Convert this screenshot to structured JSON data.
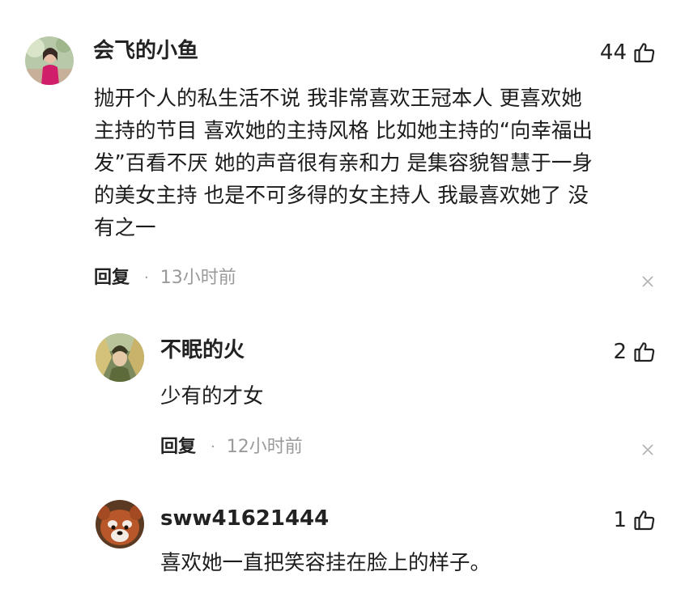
{
  "comments": [
    {
      "username": "会飞的小鱼",
      "likes": "44",
      "text_lines": [
        "抛开个人的私生活不说 我非常喜欢王冠本人 更喜欢她",
        "主持的节目 喜欢她的主持风格 比如她主持的“向幸福出",
        "发”百看不厌 她的声音很有亲和力 是集容貌智慧于一身",
        "的美女主持 也是不可多得的女主持人 我最喜欢她了 没",
        "有之一"
      ],
      "reply_label": "回复",
      "time": "13小时前"
    },
    {
      "username": "不眠的火",
      "likes": "2",
      "text_lines": [
        "少有的才女"
      ],
      "reply_label": "回复",
      "time": "12小时前"
    },
    {
      "username": "sww41621444",
      "likes": "1",
      "text_lines": [
        "喜欢她一直把笑容挂在脸上的样子。"
      ]
    }
  ],
  "icons": {
    "like": "thumbs-up-icon",
    "dismiss": "close-icon",
    "separator": "·"
  }
}
